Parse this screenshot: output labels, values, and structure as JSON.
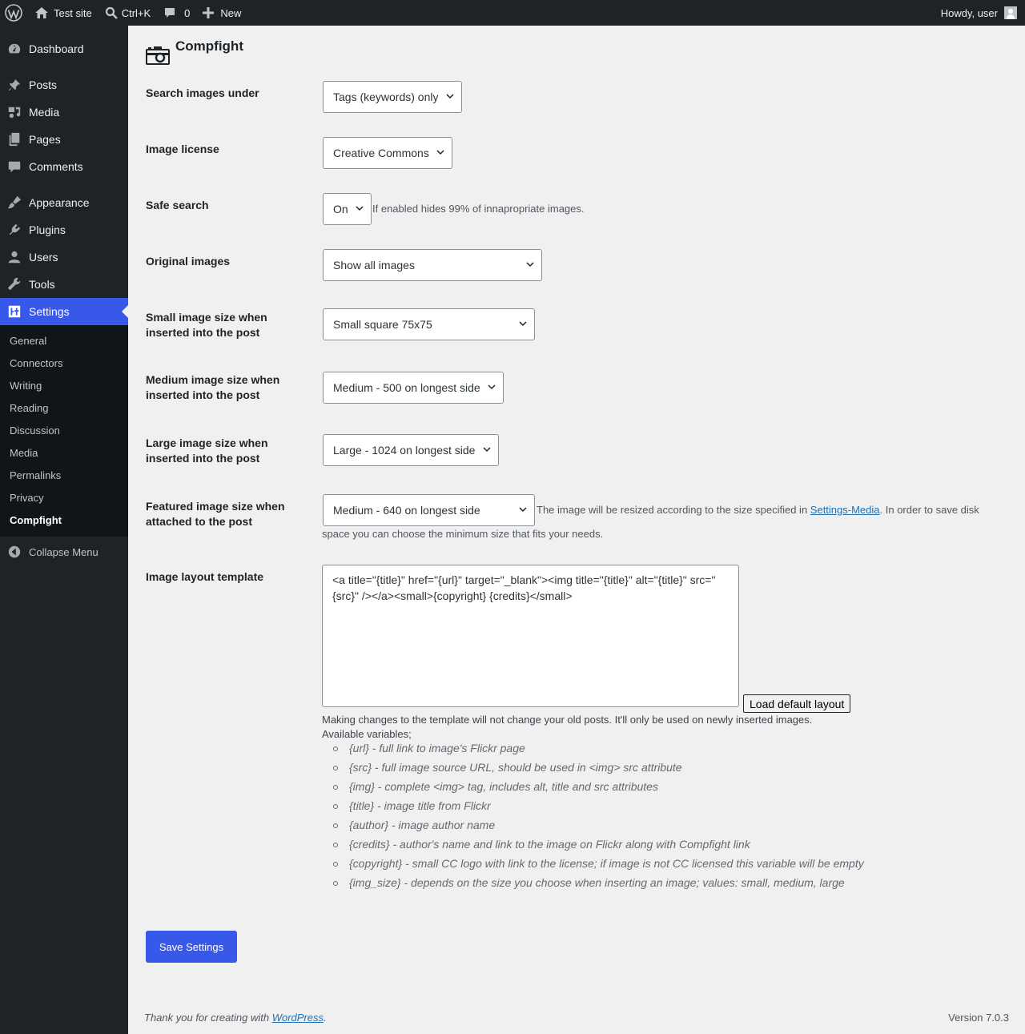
{
  "adminbar": {
    "site_name": "Test site",
    "search_shortcut": "Ctrl+K",
    "comments_count": "0",
    "new_label": "New",
    "greeting": "Howdy, user",
    "icons": [
      "wordpress-logo-icon",
      "home-icon",
      "search-icon",
      "comment-icon",
      "plus-icon"
    ]
  },
  "sidebar": {
    "items": [
      {
        "label": "Dashboard",
        "icon": "dashboard-icon"
      },
      {
        "label": "Posts",
        "icon": "pin-icon"
      },
      {
        "label": "Media",
        "icon": "media-icon"
      },
      {
        "label": "Pages",
        "icon": "pages-icon"
      },
      {
        "label": "Comments",
        "icon": "comment-icon"
      },
      {
        "label": "Appearance",
        "icon": "brush-icon"
      },
      {
        "label": "Plugins",
        "icon": "plugin-icon"
      },
      {
        "label": "Users",
        "icon": "user-icon"
      },
      {
        "label": "Tools",
        "icon": "wrench-icon"
      },
      {
        "label": "Settings",
        "icon": "settings-icon"
      }
    ],
    "submenu": [
      "General",
      "Connectors",
      "Writing",
      "Reading",
      "Discussion",
      "Media",
      "Permalinks",
      "Privacy",
      "Compfight"
    ],
    "collapse_label": "Collapse Menu",
    "accent": "#3858e9"
  },
  "page": {
    "title": "Compfight",
    "rows": [
      {
        "label": "Search images under",
        "value": "Tags (keywords) only"
      },
      {
        "label": "Image license",
        "value": "Creative Commons"
      },
      {
        "label": "Safe search",
        "value": "On",
        "desc": "If enabled hides 99% of innapropriate images."
      },
      {
        "label": "Original images",
        "value": "Show all images"
      },
      {
        "label": "Small image size when inserted into the post",
        "value": "Small square 75x75"
      },
      {
        "label": "Medium image size when inserted into the post",
        "value": "Medium - 500 on longest side"
      },
      {
        "label": "Large image size when inserted into the post",
        "value": "Large - 1024 on longest side"
      },
      {
        "label": "Featured image size when attached to the post",
        "value": "Medium - 640 on longest side"
      }
    ],
    "featured_desc_1": "The image will be resized according to the size specified in ",
    "featured_desc_link": "Settings-Media",
    "featured_desc_2": ". In order to save disk",
    "featured_desc_3": "space you can choose the minimum size that fits your needs.",
    "template_label": "Image layout template",
    "template_value": "<a title=\"{title}\" href=\"{url}\" target=\"_blank\"><img title=\"{title}\" alt=\"{title}\" src=\"{src}\" /></a><small>{copyright} {credits}</small>",
    "load_default_label": "Load default layout",
    "template_note": "Making changes to the template will not change your old posts. It'll only be used on newly inserted images.",
    "vars_title": "Available variables;",
    "vars": [
      "{url} - full link to image's Flickr page",
      "{src} - full image source URL, should be used in <img> src attribute",
      "{img} - complete <img> tag, includes alt, title and src attributes",
      "{title} - image title from Flickr",
      "{author} - image author name",
      "{credits} - author's name and link to the image on Flickr along with Compfight link",
      "{copyright} - small CC logo with link to the license; if image is not CC licensed this variable will be empty",
      "{img_size} - depends on the size you choose when inserting an image; values: small, medium, large"
    ],
    "save_label": "Save Settings"
  },
  "footer": {
    "thanks_1": "Thank you for creating with ",
    "thanks_link": "WordPress",
    "thanks_2": ".",
    "version": "Version 7.0.3"
  }
}
